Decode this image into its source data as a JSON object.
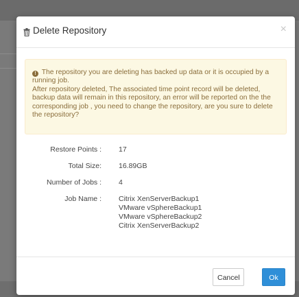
{
  "dialog": {
    "title": "Delete Repository",
    "close_label": "×",
    "warning": {
      "icon": "exclamation-circle-icon",
      "line1": "The repository you are deleting has backed up data or it is occupied by a running job.",
      "line2": "After repository deleted, The associated time point record will be deleted, backup data will remain in this repository, an error will be reported on the the corresponding job , you need to change the repository, are you sure to delete the repository?"
    },
    "details": {
      "restore_points_label": "Restore Points :",
      "restore_points_value": "17",
      "total_size_label": "Total Size:",
      "total_size_value": "16.89GB",
      "jobs_count_label": "Number of Jobs :",
      "jobs_count_value": "4",
      "job_name_label": "Job Name :",
      "job_names": [
        "Citrix XenServerBackup1",
        "VMware vSphereBackup1",
        "VMware vSphereBackup2",
        "Citrix XenServerBackup2"
      ]
    },
    "buttons": {
      "cancel_label": "Cancel",
      "ok_label": "Ok"
    },
    "colors": {
      "ok_button": "#2f8fd8",
      "warning_bg": "#fcf8e3",
      "warning_text": "#8a6d3b"
    }
  }
}
